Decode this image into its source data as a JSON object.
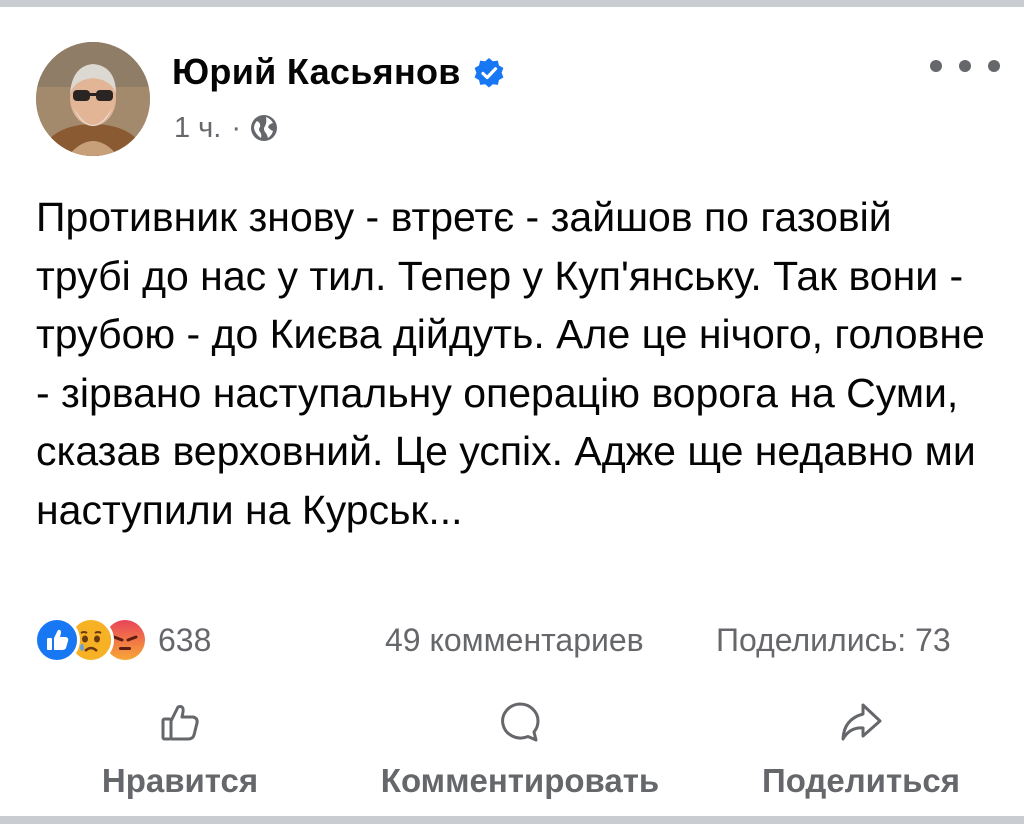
{
  "post": {
    "author": "Юрий Касьянов",
    "timestamp": "1 ч.",
    "separator": "·",
    "body": "Противник знову - втретє - зайшов по газовій трубі до нас у тил. Тепер у Куп'янську. Так вони - трубою - до Києва дійдуть. Але це нічого, головне - зірвано наступальну операцію ворога на Суми, сказав верховний. Це успіх. Адже ще недавно ми наступили на Курськ..."
  },
  "stats": {
    "reactions_count": "638",
    "reaction_icons": [
      "like-icon",
      "sad-icon",
      "angry-icon"
    ],
    "comments": "49 комментариев",
    "shares": "Поделились: 73"
  },
  "actions": {
    "like": "Нравится",
    "comment": "Комментировать",
    "share": "Поделиться"
  },
  "colors": {
    "text": "#050505",
    "secondary": "#65676b",
    "facebook_blue": "#1877f2",
    "divider": "#c9ccd1"
  }
}
